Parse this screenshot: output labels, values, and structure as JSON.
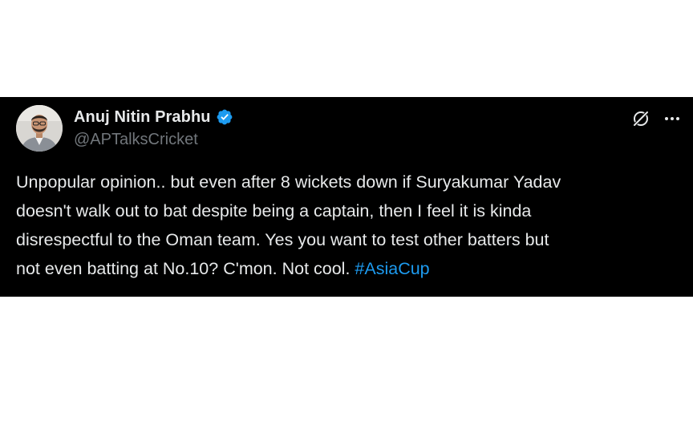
{
  "tweet": {
    "author": {
      "display_name": "Anuj Nitin Prabhu",
      "handle": "@APTalksCricket",
      "verified": true
    },
    "text_lines": [
      "Unpopular opinion.. but even after 8 wickets down if Suryakumar Yadav",
      "doesn't walk out to bat despite being a captain, then I feel it is kinda",
      "disrespectful to the Oman team. Yes you want to test other batters but",
      "not even batting at No.10? C'mon. Not cool. "
    ],
    "hashtag": "#AsiaCup",
    "icons": {
      "verified": "verified-badge-icon",
      "grok": "grok-icon",
      "more": "more-options-icon"
    }
  },
  "colors": {
    "card_background": "#000000",
    "page_background": "#ffffff",
    "primary_text": "#e7e9ea",
    "secondary_text": "#71767b",
    "accent": "#1d9bf0"
  }
}
